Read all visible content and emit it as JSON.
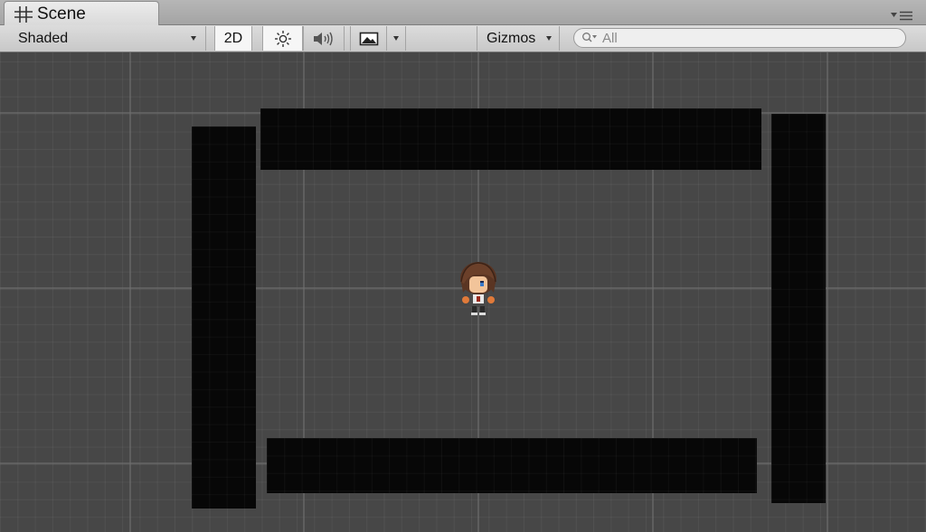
{
  "window": {
    "tab_title": "Scene",
    "tab_icon": "grid-hash-icon",
    "panel_menu_icon": "panel-options-icon"
  },
  "toolbar": {
    "render_mode": "Shaded",
    "mode_2d_label": "2D",
    "mode_2d_active": true,
    "lighting_icon": "sun-icon",
    "lighting_active": true,
    "audio_icon": "speaker-icon",
    "effects_icon": "image-icon",
    "gizmos_label": "Gizmos",
    "search_placeholder": "All"
  },
  "scene": {
    "background_color": "#474747",
    "wall_color": "#070707",
    "objects": [
      "wall-top",
      "wall-left",
      "wall-right",
      "wall-bottom",
      "player-character"
    ]
  }
}
